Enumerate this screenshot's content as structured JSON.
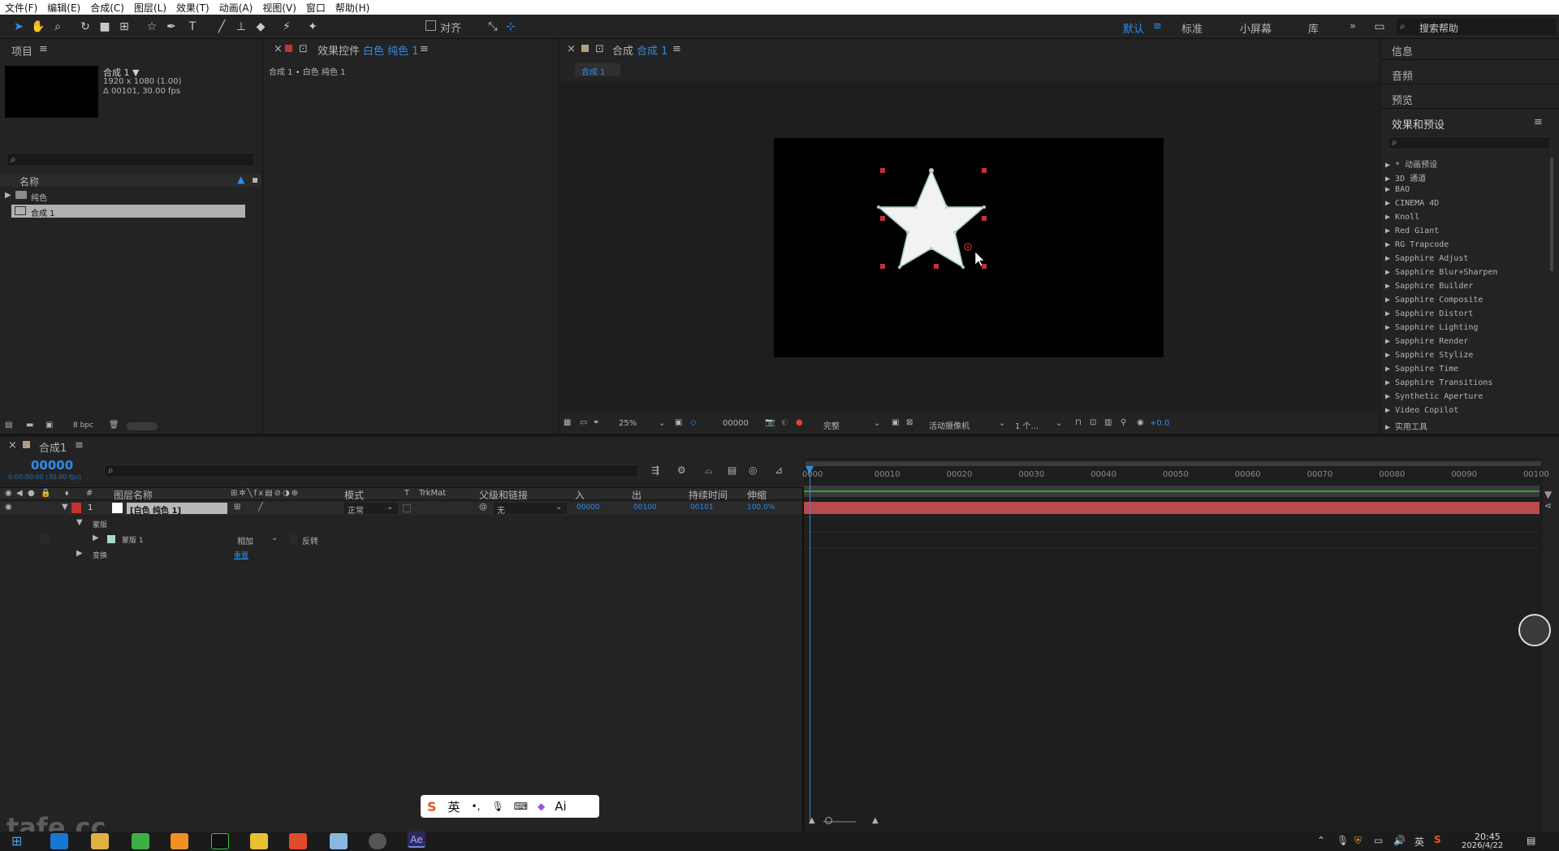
{
  "menubar": {
    "items": [
      "文件(F)",
      "编辑(E)",
      "合成(C)",
      "图层(L)",
      "效果(T)",
      "动画(A)",
      "视图(V)",
      "窗口",
      "帮助(H)"
    ]
  },
  "toolbar": {
    "align_label": "对齐",
    "workspaces": [
      "默认",
      "标准",
      "小屏幕",
      "库"
    ],
    "more": "»",
    "help_placeholder": "搜索帮助"
  },
  "project": {
    "tab": "项目",
    "comp_name": "合成 1 ▼",
    "comp_size": "1920 x 1080 (1.00)",
    "comp_duration": "Δ 00101, 30.00 fps",
    "name_header": "名称",
    "items": [
      {
        "label": "纯色"
      },
      {
        "label": "合成 1"
      }
    ],
    "bpc": "8 bpc"
  },
  "effects_controls": {
    "tab_prefix": "效果控件",
    "tab_layer": "白色 纯色 1",
    "breadcrumb": "合成 1 • 白色 纯色 1"
  },
  "composition": {
    "tab_prefix": "合成",
    "tab_name": "合成 1",
    "subtab": "合成 1"
  },
  "viewer_bar": {
    "zoom": "25%",
    "timecode": "00000",
    "resolution": "完整",
    "camera": "活动摄像机",
    "views": "1 个...",
    "exposure": "+0.0"
  },
  "right_panel": {
    "sections": [
      "信息",
      "音频",
      "预览"
    ],
    "effects_title": "效果和预设",
    "items": [
      "* 动画预设",
      "3D 通道",
      "BAO",
      "CINEMA 4D",
      "Knoll",
      "Red Giant",
      "RG Trapcode",
      "Sapphire Adjust",
      "Sapphire Blur+Sharpen",
      "Sapphire Builder",
      "Sapphire Composite",
      "Sapphire Distort",
      "Sapphire Lighting",
      "Sapphire Render",
      "Sapphire Stylize",
      "Sapphire Time",
      "Sapphire Transitions",
      "Synthetic Aperture",
      "Video Copilot",
      "实用工具"
    ]
  },
  "timeline": {
    "tab": "合成1",
    "timecode": "00000",
    "timecode_sub": "0:00:00:00 (30.00 fps)",
    "headers": {
      "num": "#",
      "name": "图层名称",
      "mode": "模式",
      "t": "T",
      "trkmat": "TrkMat",
      "parent": "父级和链接",
      "in": "入",
      "out": "出",
      "duration": "持续时间",
      "stretch": "伸缩"
    },
    "layer": {
      "num": "1",
      "name": "[白色 纯色 1]",
      "mode": "正常",
      "parent": "无",
      "in": "00000",
      "out": "00100",
      "duration": "00101",
      "stretch": "100.0%"
    },
    "sub": {
      "masks": "蒙版",
      "mask1": "蒙版 1",
      "mask_mode": "相加",
      "invert": "反转",
      "transform": "变换",
      "reset": "重置"
    },
    "ruler": [
      "0000",
      "00010",
      "00020",
      "00030",
      "00040",
      "00050",
      "00060",
      "00070",
      "00080",
      "00090",
      "00100"
    ]
  },
  "ime": {
    "lang": "英",
    "ai": "Ai"
  },
  "watermark": "tafe.cc",
  "taskbar": {
    "time": "20:45",
    "date": "2026/4/22",
    "ime": "英"
  }
}
